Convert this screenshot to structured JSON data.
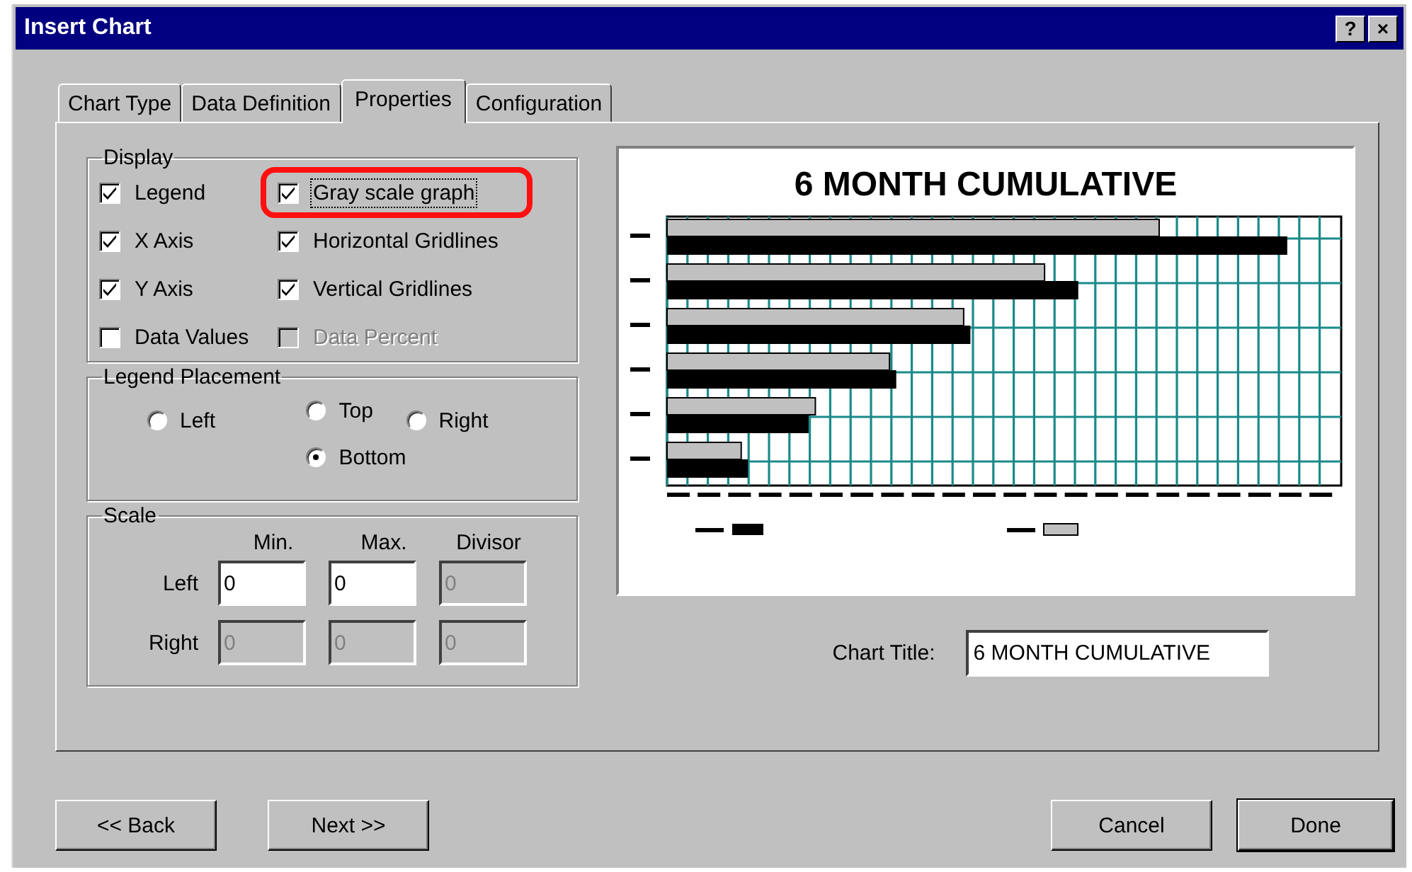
{
  "window": {
    "title": "Insert Chart",
    "title_buttons": [
      "?",
      "×"
    ]
  },
  "tabs": [
    {
      "label": "Chart Type",
      "selected": false
    },
    {
      "label": "Data Definition",
      "selected": false
    },
    {
      "label": "Properties",
      "selected": true
    },
    {
      "label": "Configuration",
      "selected": false
    }
  ],
  "display": {
    "title": "Display",
    "options": [
      {
        "label": "Legend",
        "checked": true,
        "disabled": false,
        "focused": false,
        "highlighted": false
      },
      {
        "label": "Gray scale graph",
        "checked": true,
        "disabled": false,
        "focused": true,
        "highlighted": true
      },
      {
        "label": "X Axis",
        "checked": true,
        "disabled": false,
        "focused": false,
        "highlighted": false
      },
      {
        "label": "Horizontal Gridlines",
        "checked": true,
        "disabled": false,
        "focused": false,
        "highlighted": false
      },
      {
        "label": "Y Axis",
        "checked": true,
        "disabled": false,
        "focused": false,
        "highlighted": false
      },
      {
        "label": "Vertical Gridlines",
        "checked": true,
        "disabled": false,
        "focused": false,
        "highlighted": false
      },
      {
        "label": "Data Values",
        "checked": false,
        "disabled": false,
        "focused": false,
        "highlighted": false
      },
      {
        "label": "Data Percent",
        "checked": false,
        "disabled": true,
        "focused": false,
        "highlighted": false
      }
    ]
  },
  "legend_placement": {
    "title": "Legend Placement",
    "options": [
      {
        "label": "Left",
        "selected": false
      },
      {
        "label": "Top",
        "selected": false
      },
      {
        "label": "Bottom",
        "selected": true
      },
      {
        "label": "Right",
        "selected": false
      }
    ]
  },
  "scale": {
    "title": "Scale",
    "columns": [
      "Min.",
      "Max.",
      "Divisor"
    ],
    "rows": [
      {
        "label": "Left",
        "fields": [
          {
            "value": "0",
            "disabled": false
          },
          {
            "value": "0",
            "disabled": false
          },
          {
            "value": "0",
            "disabled": true
          }
        ]
      },
      {
        "label": "Right",
        "fields": [
          {
            "value": "0",
            "disabled": true
          },
          {
            "value": "0",
            "disabled": true
          },
          {
            "value": "0",
            "disabled": true
          }
        ]
      }
    ]
  },
  "preview": {
    "title": "6 MONTH CUMULATIVE"
  },
  "chart_title": {
    "label": "Chart Title:",
    "value": "6 MONTH CUMULATIVE"
  },
  "nav_buttons": [
    {
      "label": "<< Back"
    },
    {
      "label": "Next >>"
    }
  ],
  "buttons": [
    {
      "label": "Cancel",
      "default": false
    },
    {
      "label": "Done",
      "default": true
    }
  ]
}
